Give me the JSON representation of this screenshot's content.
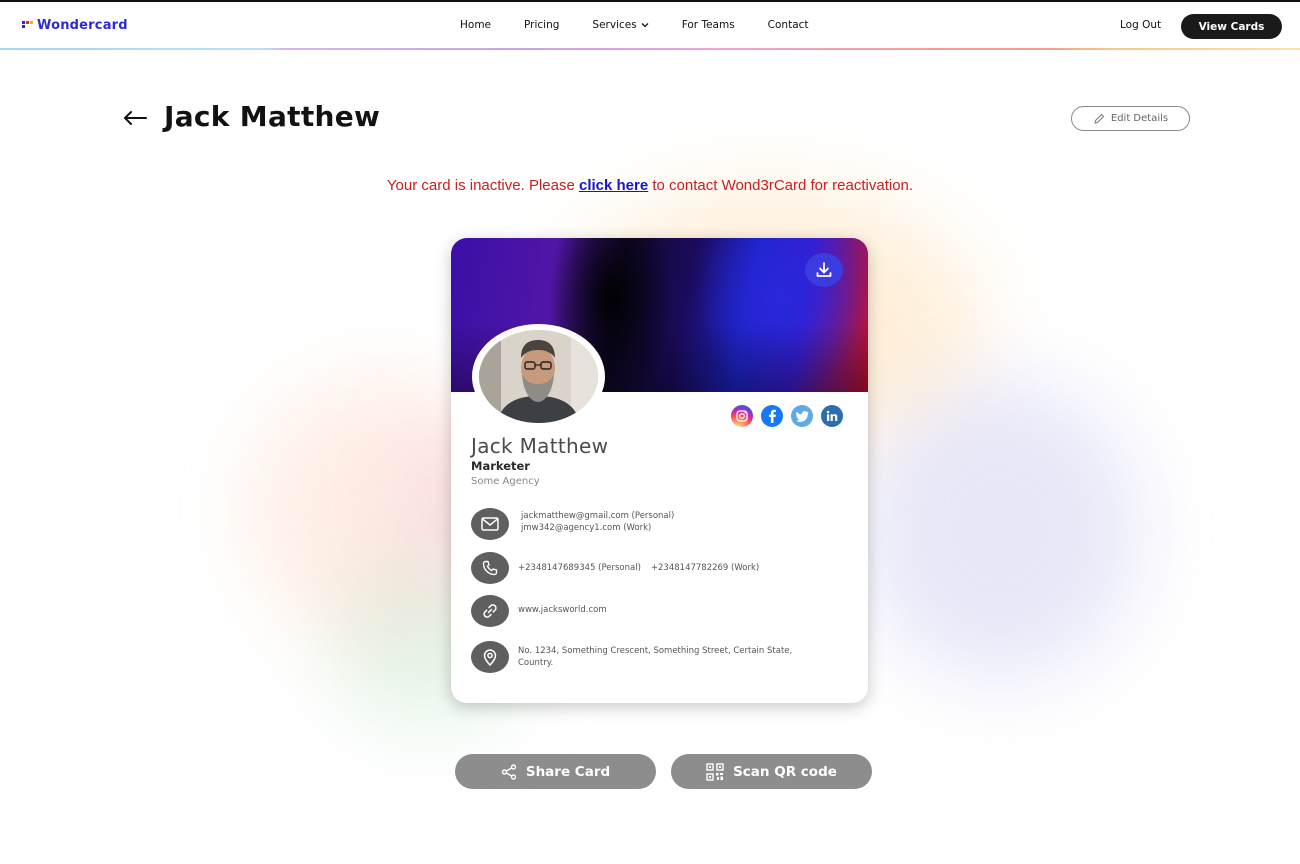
{
  "brand": {
    "name": "Wondercard",
    "colors": {
      "accent": "#2b2bd6",
      "logo": [
        "#2b2bd6",
        "#e52b2b",
        "#f2b400"
      ]
    }
  },
  "nav": {
    "items": [
      {
        "label": "Home"
      },
      {
        "label": "Pricing"
      },
      {
        "label": "Services",
        "icon": "chevron-down-icon"
      },
      {
        "label": "For Teams"
      },
      {
        "label": "Contact"
      }
    ],
    "logout_label": "Log Out",
    "view_cards_label": "View Cards"
  },
  "header": {
    "back_icon": "arrow-left-icon",
    "title": "Jack Matthew",
    "edit_label": "Edit Details"
  },
  "notice": {
    "prefix": "Your card is inactive. Please",
    "link": "click here",
    "suffix": "to contact Wond3rCard for reactivation.",
    "color": "#c8201f"
  },
  "card": {
    "name": "Jack Matthew",
    "role": "Marketer",
    "company": "Some Agency",
    "socials": [
      {
        "name": "instagram-icon",
        "color": "#d62976"
      },
      {
        "name": "facebook-icon",
        "color": "#1877f2"
      },
      {
        "name": "twitter-icon",
        "color": "#1da1f2"
      },
      {
        "name": "linkedin-icon",
        "color": "#0a66c2"
      }
    ],
    "email": {
      "personal": "jackmatthew@gmail.com (Personal)",
      "work": "jmw342@agency1.com (Work)"
    },
    "phone": {
      "personal": "+2348147689345 (Personal)",
      "work": "+2348147782269 (Work)"
    },
    "website": "www.jacksworld.com",
    "address": {
      "line1": "No. 1234, Something Crescent, Something Street, Certain State,",
      "line2": "Country."
    }
  },
  "actions": {
    "share_label": "Share Card",
    "scan_label": "Scan QR code"
  }
}
